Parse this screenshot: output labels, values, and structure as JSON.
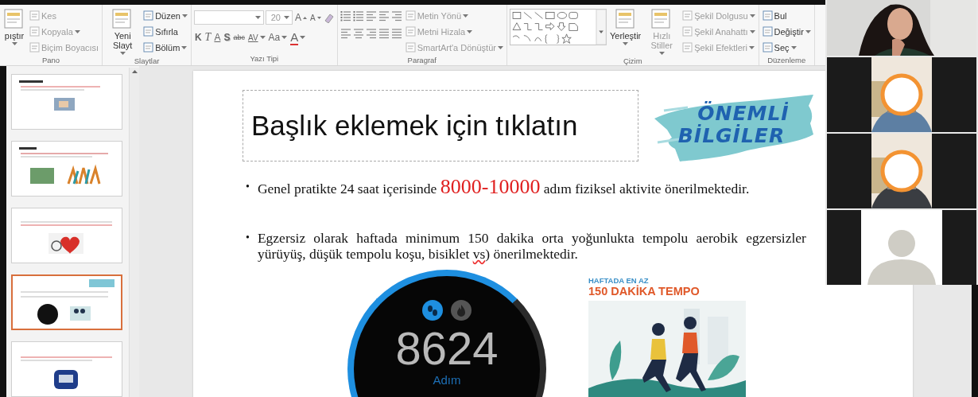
{
  "ribbon": {
    "groups": [
      {
        "label": "Pano",
        "columns": [
          [
            {
              "kind": "large",
              "label": "pıştır",
              "dropdown": true,
              "disabled": false
            }
          ],
          [
            {
              "kind": "small",
              "label": "Kes",
              "dropdown": false,
              "disabled": true
            },
            {
              "kind": "small",
              "label": "Kopyala",
              "dropdown": true,
              "disabled": true
            },
            {
              "kind": "small",
              "label": "Biçim Boyacısı",
              "dropdown": false,
              "disabled": true
            }
          ]
        ]
      },
      {
        "label": "Slaytlar",
        "columns": [
          [
            {
              "kind": "large",
              "label": "Yeni Slayt",
              "dropdown": true,
              "disabled": false
            }
          ],
          [
            {
              "kind": "small",
              "label": "Düzen",
              "dropdown": true,
              "disabled": false
            },
            {
              "kind": "small",
              "label": "Sıfırla",
              "dropdown": false,
              "disabled": false
            },
            {
              "kind": "small",
              "label": "Bölüm",
              "dropdown": true,
              "disabled": false
            }
          ]
        ]
      },
      {
        "label": "Yazı Tipi",
        "columns": [
          [
            {
              "kind": "row",
              "items": [
                {
                  "kind": "font-field"
                },
                {
                  "kind": "size-field",
                  "value": "20"
                },
                {
                  "kind": "grow",
                  "label": "A",
                  "dropdown": false
                },
                {
                  "kind": "shrink",
                  "label": "A",
                  "dropdown": false
                },
                {
                  "kind": "eraser"
                }
              ]
            },
            {
              "kind": "row",
              "items": [
                {
                  "kind": "bold",
                  "label": "K",
                  "dropdown": false
                },
                {
                  "kind": "italic",
                  "label": "T",
                  "dropdown": false
                },
                {
                  "kind": "underline",
                  "label": "A",
                  "dropdown": false
                },
                {
                  "kind": "shadow",
                  "label": "S",
                  "dropdown": false
                },
                {
                  "kind": "strike",
                  "label": "abc",
                  "dropdown": false
                },
                {
                  "kind": "spacing",
                  "label": "AV",
                  "dropdown": true
                },
                {
                  "kind": "case",
                  "label": "Aa",
                  "dropdown": true
                },
                {
                  "kind": "color",
                  "label": "A",
                  "dropdown": true
                }
              ]
            }
          ]
        ]
      },
      {
        "label": "Paragraf",
        "columns": [
          [
            {
              "kind": "para-tools"
            }
          ],
          [
            {
              "kind": "small",
              "label": "Metin Yönü",
              "dropdown": true,
              "disabled": true
            },
            {
              "kind": "small",
              "label": "Metni Hizala",
              "dropdown": true,
              "disabled": true
            },
            {
              "kind": "small",
              "label": "SmartArt'a Dönüştür",
              "dropdown": true,
              "disabled": true
            }
          ]
        ]
      },
      {
        "label": "Çizim",
        "columns": [
          [
            {
              "kind": "shapes-gallery"
            }
          ],
          [
            {
              "kind": "large",
              "label": "Yerleştir",
              "dropdown": true,
              "disabled": false
            }
          ],
          [
            {
              "kind": "large",
              "label": "Hızlı Stiller",
              "dropdown": true,
              "disabled": true
            }
          ],
          [
            {
              "kind": "small",
              "label": "Şekil Dolgusu",
              "dropdown": true,
              "disabled": true
            },
            {
              "kind": "small",
              "label": "Şekil Anahattı",
              "dropdown": true,
              "disabled": true
            },
            {
              "kind": "small",
              "label": "Şekil Efektleri",
              "dropdown": true,
              "disabled": true
            }
          ]
        ]
      },
      {
        "label": "Düzenleme",
        "columns": [
          [
            {
              "kind": "small",
              "label": "Bul",
              "dropdown": false,
              "disabled": false
            },
            {
              "kind": "small",
              "label": "Değiştir",
              "dropdown": true,
              "disabled": false
            },
            {
              "kind": "small",
              "label": "Seç",
              "dropdown": true,
              "disabled": false
            }
          ]
        ]
      }
    ]
  },
  "thumbnails": [
    {
      "selected": false
    },
    {
      "selected": false
    },
    {
      "selected": false
    },
    {
      "selected": true
    },
    {
      "selected": false
    }
  ],
  "slide": {
    "title": "Başlık eklemek için tıklatın",
    "badge": [
      "ÖNEMLİ",
      "BİLGİLER"
    ],
    "bullets": [
      {
        "marker": "•",
        "parts": [
          {
            "text": "Genel pratikte 24 saat içerisinde ",
            "kind": "plain"
          },
          {
            "text": "8000-10000",
            "kind": "highlight"
          },
          {
            "text": " adım fiziksel aktivite önerilmektedir.",
            "kind": "plain"
          }
        ]
      },
      {
        "marker": "•",
        "parts": [
          {
            "text": "Egzersiz olarak haftada minimum 150 dakika orta yoğunlukta tempolu aerobik egzersizler yürüyüş, düşük tempolu koşu, bisiklet ",
            "kind": "plain"
          },
          {
            "text": "vs",
            "kind": "misspelled"
          },
          {
            "text": ") önerilmektedir.",
            "kind": "plain"
          }
        ]
      }
    ],
    "watch": {
      "count": "8624",
      "unit": "Adım"
    },
    "poster": {
      "kicker": "HAFTADA EN AZ",
      "headline": "150 DAKİKA TEMPO"
    }
  },
  "video": {
    "tiles": [
      {
        "kind": "camera"
      },
      {
        "kind": "masked"
      },
      {
        "kind": "masked"
      },
      {
        "kind": "avatar"
      }
    ]
  }
}
